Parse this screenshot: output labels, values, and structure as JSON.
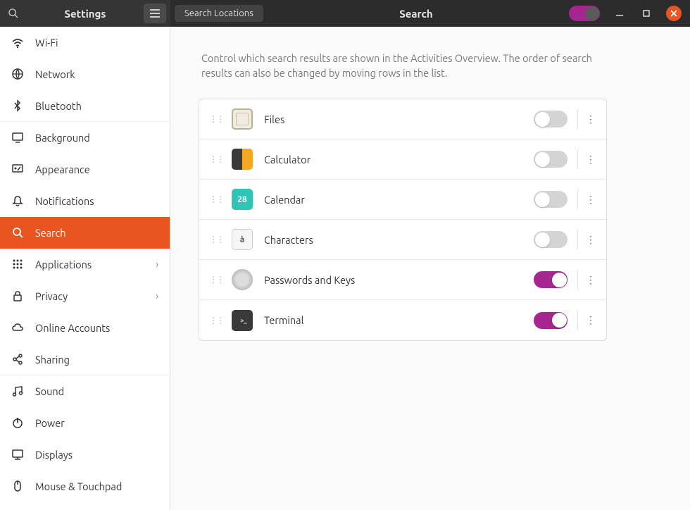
{
  "titlebar": {
    "app_title": "Settings",
    "search_locations": "Search Locations",
    "panel_title": "Search"
  },
  "sidebar": {
    "items": [
      {
        "icon": "wifi",
        "label": "Wi-Fi"
      },
      {
        "icon": "globe",
        "label": "Network"
      },
      {
        "icon": "bluetooth",
        "label": "Bluetooth",
        "divider": true
      },
      {
        "icon": "monitor",
        "label": "Background"
      },
      {
        "icon": "appearance",
        "label": "Appearance"
      },
      {
        "icon": "bell",
        "label": "Notifications"
      },
      {
        "icon": "search",
        "label": "Search",
        "selected": true
      },
      {
        "icon": "apps",
        "label": "Applications",
        "chevron": true
      },
      {
        "icon": "lock",
        "label": "Privacy",
        "chevron": true
      },
      {
        "icon": "cloud",
        "label": "Online Accounts"
      },
      {
        "icon": "share",
        "label": "Sharing",
        "divider": true
      },
      {
        "icon": "music",
        "label": "Sound"
      },
      {
        "icon": "power",
        "label": "Power"
      },
      {
        "icon": "displays",
        "label": "Displays"
      },
      {
        "icon": "mouse",
        "label": "Mouse & Touchpad"
      }
    ]
  },
  "content": {
    "description": "Control which search results are shown in the Activities Overview. The order of search results can also be changed by moving rows in the list.",
    "rows": [
      {
        "name": "Files",
        "icon": "files",
        "enabled": false
      },
      {
        "name": "Calculator",
        "icon": "calc",
        "enabled": false
      },
      {
        "name": "Calendar",
        "icon": "cal",
        "icon_text": "28",
        "enabled": false
      },
      {
        "name": "Characters",
        "icon": "chars",
        "icon_text": "à",
        "enabled": false
      },
      {
        "name": "Passwords and Keys",
        "icon": "keys",
        "enabled": true
      },
      {
        "name": "Terminal",
        "icon": "term",
        "icon_text": ">_",
        "enabled": true
      }
    ]
  }
}
